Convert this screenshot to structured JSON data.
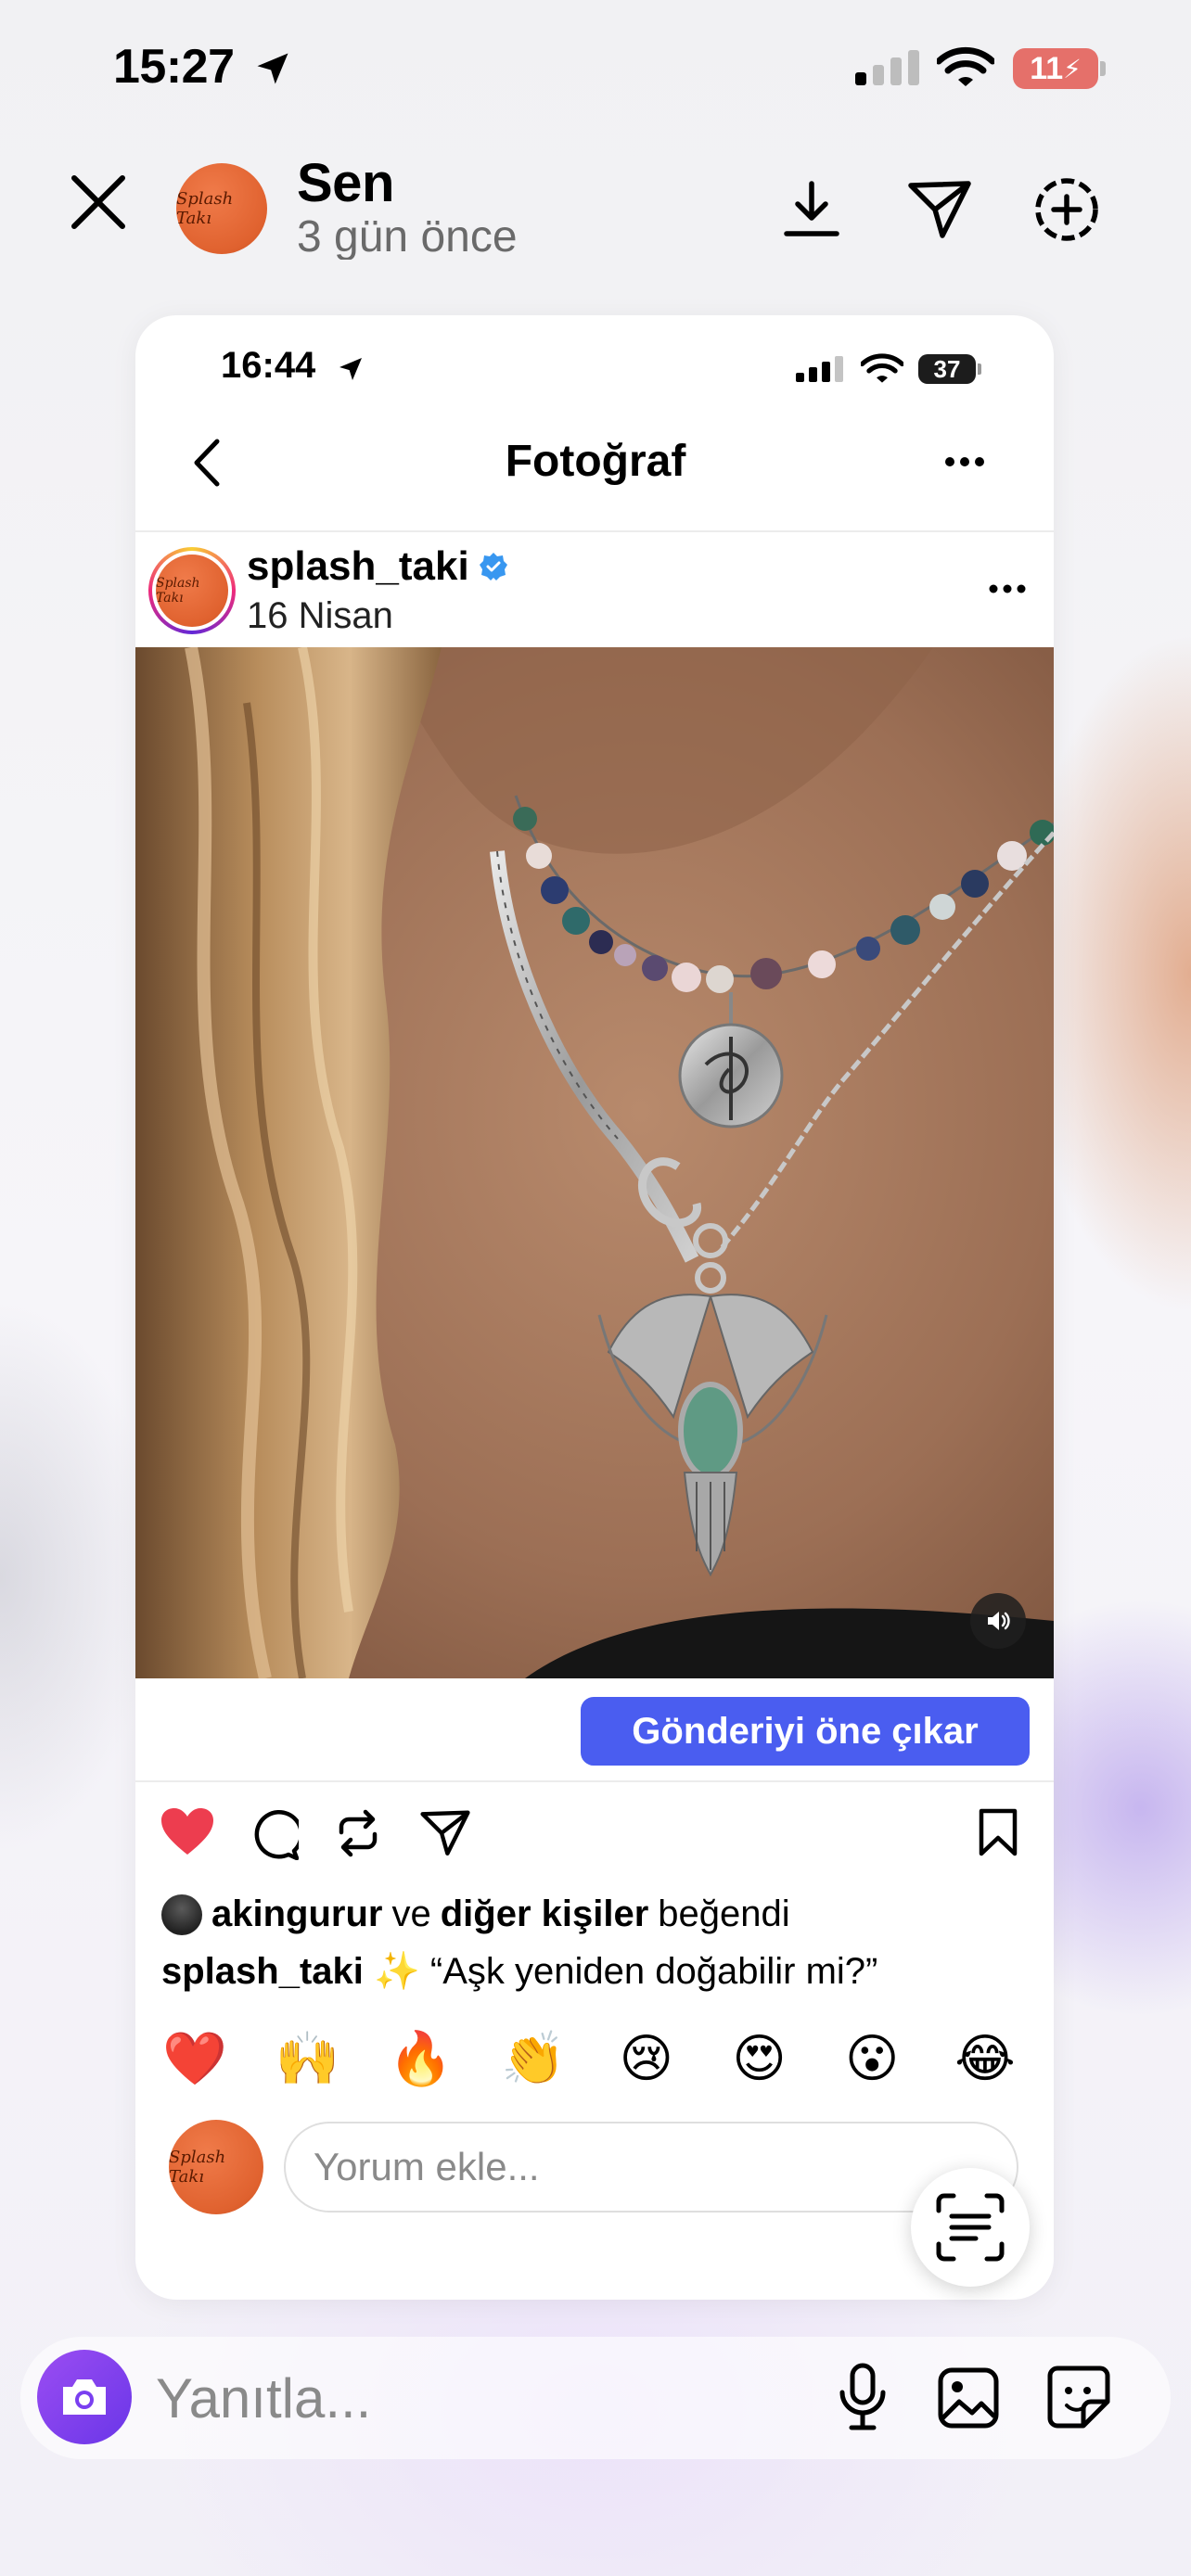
{
  "status_bar": {
    "time": "15:27",
    "battery": "11"
  },
  "story_header": {
    "author": "Sen",
    "time_ago": "3 gün önce",
    "avatar_text": "Splash Takı"
  },
  "inner_status_bar": {
    "time": "16:44",
    "battery": "37"
  },
  "inner_nav": {
    "title": "Fotoğraf"
  },
  "post": {
    "username": "splash_taki",
    "verified": true,
    "date": "16 Nisan",
    "promote_label": "Gönderiyi öne çıkar",
    "liked": true,
    "likes": {
      "user": "akingurur",
      "and": "ve",
      "others": "diğer kişiler",
      "suffix": "beğendi"
    },
    "caption": {
      "user": "splash_taki",
      "text": "✨ “Aşk yeniden doğabilir mi?”"
    }
  },
  "reactions": [
    "❤️",
    "🙌",
    "🔥",
    "👏",
    "😢",
    "😍",
    "😮",
    "😂"
  ],
  "comment": {
    "placeholder": "Yorum ekle..."
  },
  "reply": {
    "placeholder": "Yanıtla..."
  },
  "colors": {
    "accent": "#4a5df0",
    "like": "#ed3d4f",
    "battery_low": "#e5706a",
    "camera": "#7a3ff0"
  }
}
